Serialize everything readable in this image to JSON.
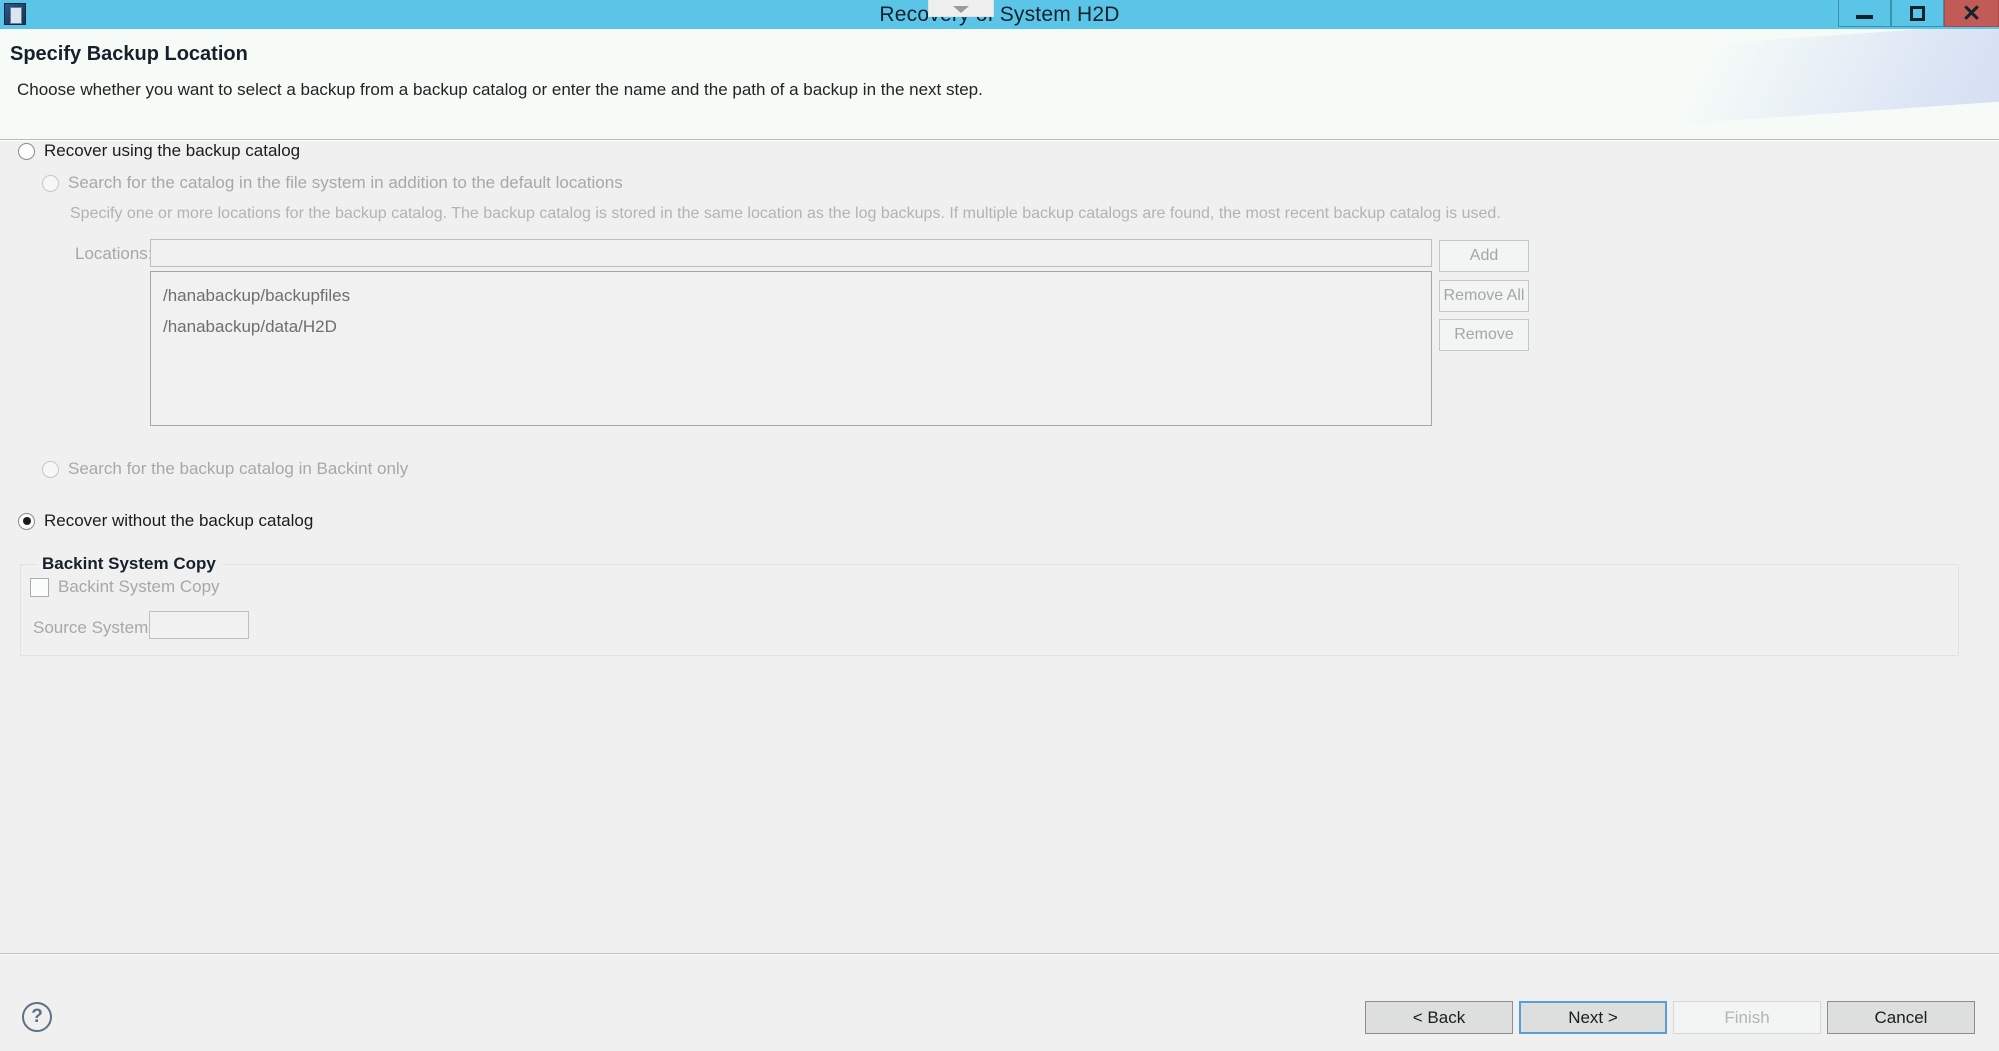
{
  "window": {
    "title": "Recovery of System H2D",
    "app_icon": "application-icon",
    "overlay_icon": "chevron-down-icon",
    "controls": {
      "minimize": "minimize-icon",
      "maximize": "maximize-icon",
      "close": "close-icon"
    },
    "titlebar_color": "#5bc5e8",
    "close_color": "#c15b57"
  },
  "header": {
    "title": "Specify Backup Location",
    "description": "Choose whether you want to select a backup from a backup catalog or enter the name and the path of a backup in the next step."
  },
  "options": {
    "use_catalog": {
      "label": "Recover using the backup catalog",
      "checked": false,
      "enabled": true
    },
    "search_filesystem": {
      "label": "Search for the catalog in the file system in addition to the default locations",
      "checked": false,
      "enabled": false
    },
    "search_filesystem_hint": "Specify one or more locations for the backup catalog. The backup catalog is stored in the same location as the log backups. If multiple backup catalogs are found, the most recent backup catalog is used.",
    "search_backint": {
      "label": "Search for the backup catalog in Backint only",
      "checked": false,
      "enabled": false
    },
    "without_catalog": {
      "label": "Recover without the backup catalog",
      "checked": true,
      "enabled": true
    }
  },
  "locations": {
    "label": "Locations:",
    "input_value": "",
    "input_placeholder": "",
    "items": [
      "/hanabackup/backupfiles",
      "/hanabackup/data/H2D"
    ],
    "buttons": [
      {
        "label": "Add",
        "enabled": false
      },
      {
        "label": "Remove All",
        "enabled": false
      },
      {
        "label": "Remove",
        "enabled": false
      }
    ]
  },
  "backint_group": {
    "title": "Backint System Copy",
    "checkbox_label": "Backint System Copy",
    "checkbox_checked": false,
    "source_system_label": "Source System:",
    "source_system_value": "",
    "source_system_enabled": false
  },
  "footer": {
    "help_glyph": "?",
    "buttons": [
      {
        "label": "< Back",
        "enabled": true,
        "focused": false
      },
      {
        "label": "Next >",
        "enabled": true,
        "focused": true
      },
      {
        "label": "Finish",
        "enabled": false,
        "focused": false
      },
      {
        "label": "Cancel",
        "enabled": true,
        "focused": false
      }
    ]
  }
}
